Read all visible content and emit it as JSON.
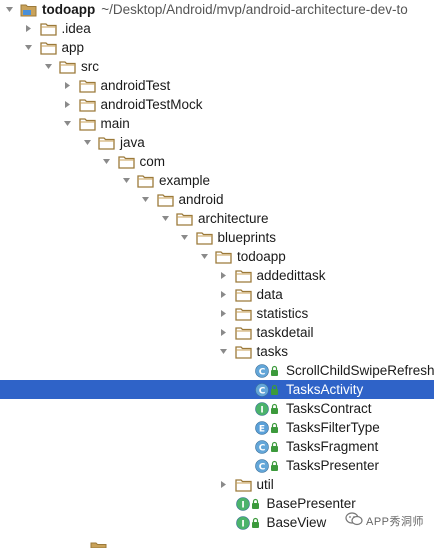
{
  "project": {
    "name": "todoapp",
    "path": "~/Desktop/Android/mvp/android-architecture-dev-to"
  },
  "tree": {
    "rows": [
      {
        "label": ".idea",
        "kind": "folder",
        "expanded": false,
        "depth": 1
      },
      {
        "label": "app",
        "kind": "folder",
        "expanded": true,
        "depth": 1
      },
      {
        "label": "src",
        "kind": "folder",
        "expanded": true,
        "depth": 2
      },
      {
        "label": "androidTest",
        "kind": "folder",
        "expanded": false,
        "depth": 3
      },
      {
        "label": "androidTestMock",
        "kind": "folder",
        "expanded": false,
        "depth": 3
      },
      {
        "label": "main",
        "kind": "folder",
        "expanded": true,
        "depth": 3
      },
      {
        "label": "java",
        "kind": "folder",
        "expanded": true,
        "depth": 4
      },
      {
        "label": "com",
        "kind": "folder",
        "expanded": true,
        "depth": 5
      },
      {
        "label": "example",
        "kind": "folder",
        "expanded": true,
        "depth": 6
      },
      {
        "label": "android",
        "kind": "folder",
        "expanded": true,
        "depth": 7
      },
      {
        "label": "architecture",
        "kind": "folder",
        "expanded": true,
        "depth": 8
      },
      {
        "label": "blueprints",
        "kind": "folder",
        "expanded": true,
        "depth": 9
      },
      {
        "label": "todoapp",
        "kind": "folder",
        "expanded": true,
        "depth": 10
      },
      {
        "label": "addedittask",
        "kind": "folder",
        "expanded": false,
        "depth": 11
      },
      {
        "label": "data",
        "kind": "folder",
        "expanded": false,
        "depth": 11
      },
      {
        "label": "statistics",
        "kind": "folder",
        "expanded": false,
        "depth": 11
      },
      {
        "label": "taskdetail",
        "kind": "folder",
        "expanded": false,
        "depth": 11
      },
      {
        "label": "tasks",
        "kind": "folder",
        "expanded": true,
        "depth": 11
      },
      {
        "label": "ScrollChildSwipeRefresh",
        "kind": "class",
        "icon": "class-icon",
        "letter": "C",
        "depth": 12
      },
      {
        "label": "TasksActivity",
        "kind": "class",
        "icon": "class-icon",
        "letter": "C",
        "depth": 12,
        "selected": true
      },
      {
        "label": "TasksContract",
        "kind": "interface",
        "icon": "interface-icon",
        "letter": "I",
        "depth": 12
      },
      {
        "label": "TasksFilterType",
        "kind": "enum",
        "icon": "enum-icon",
        "letter": "E",
        "depth": 12
      },
      {
        "label": "TasksFragment",
        "kind": "class",
        "icon": "class-icon",
        "letter": "C",
        "depth": 12
      },
      {
        "label": "TasksPresenter",
        "kind": "class",
        "icon": "class-icon",
        "letter": "C",
        "depth": 12
      },
      {
        "label": "util",
        "kind": "folder",
        "expanded": false,
        "depth": 11
      },
      {
        "label": "BasePresenter",
        "kind": "interface",
        "icon": "interface-icon",
        "letter": "I",
        "depth": 11
      },
      {
        "label": "BaseView",
        "kind": "interface",
        "icon": "interface-icon",
        "letter": "I",
        "depth": 11
      }
    ]
  },
  "watermark": {
    "text": "APP秀洞师",
    "icon": "wechat-icon"
  },
  "colors": {
    "folder": "#c9a25a",
    "folder_dark": "#9c7a3a",
    "selection": "#2f63c8",
    "class_icon": "#63a6d8",
    "interface_icon": "#4bb36b",
    "enum_icon": "#5aa0d8",
    "lock": "#3c9a3c",
    "arrow": "#8a8a8a"
  }
}
